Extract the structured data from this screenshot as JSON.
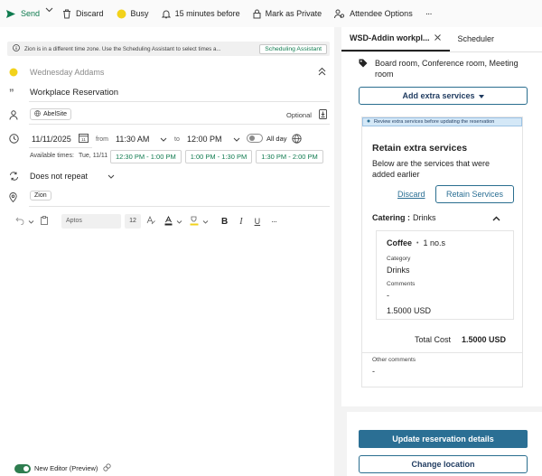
{
  "toolbar": {
    "send": "Send",
    "discard": "Discard",
    "busy": "Busy",
    "reminder": "15 minutes before",
    "private": "Mark as Private",
    "attendee": "Attendee Options",
    "more": "···"
  },
  "info_bar": {
    "text": "Zion is in a different time zone. Use the Scheduling Assistant to select times a...",
    "button": "Scheduling Assistant"
  },
  "event": {
    "organizer": "Wednesday Addams",
    "title": "Workplace Reservation",
    "attendee": "AbelSite",
    "optional": "Optional",
    "start_date": "11/11/2025",
    "from": "from",
    "start_time": "11:30 AM",
    "to": "to",
    "end_time": "12:00 PM",
    "all_day": "All day",
    "available_label": "Available times:",
    "available_day": "Tue, 11/11",
    "slots": [
      "12:30 PM - 1:00 PM",
      "1:00 PM - 1:30 PM",
      "1:30 PM - 2:00 PM"
    ],
    "repeat": "Does not repeat",
    "location": "Zion"
  },
  "editor": {
    "font": "Aptos",
    "size": "12",
    "more": "···",
    "new_editor": "New Editor (Preview)"
  },
  "side_panel": {
    "tab_active": "WSD-Addin workpl...",
    "tab_other": "Scheduler",
    "rooms": "Board room, Conference room, Meeting room",
    "add_extra": "Add extra services",
    "notice": "Review extra services before updating the reservation",
    "retain_title": "Retain extra services",
    "retain_desc": "Below are the services that were added earlier",
    "discard": "Discard",
    "retain_btn": "Retain Services",
    "catering_label": "Catering :",
    "catering_value": "Drinks",
    "item_name": "Coffee",
    "item_qty": "1 no.s",
    "category_label": "Category",
    "category_value": "Drinks",
    "comments_label": "Comments",
    "comments_value": "-",
    "item_price": "1.5000 USD",
    "total_label": "Total Cost",
    "total_value": "1.5000 USD",
    "other_label": "Other comments",
    "other_value": "-",
    "update_btn": "Update reservation details",
    "change_btn": "Change location"
  },
  "colors": {
    "accent_green": "#0f7b4f",
    "busy_yellow": "#f2d21b",
    "primary_blue": "#2b6f94",
    "navy_text": "#1e3a5f"
  }
}
